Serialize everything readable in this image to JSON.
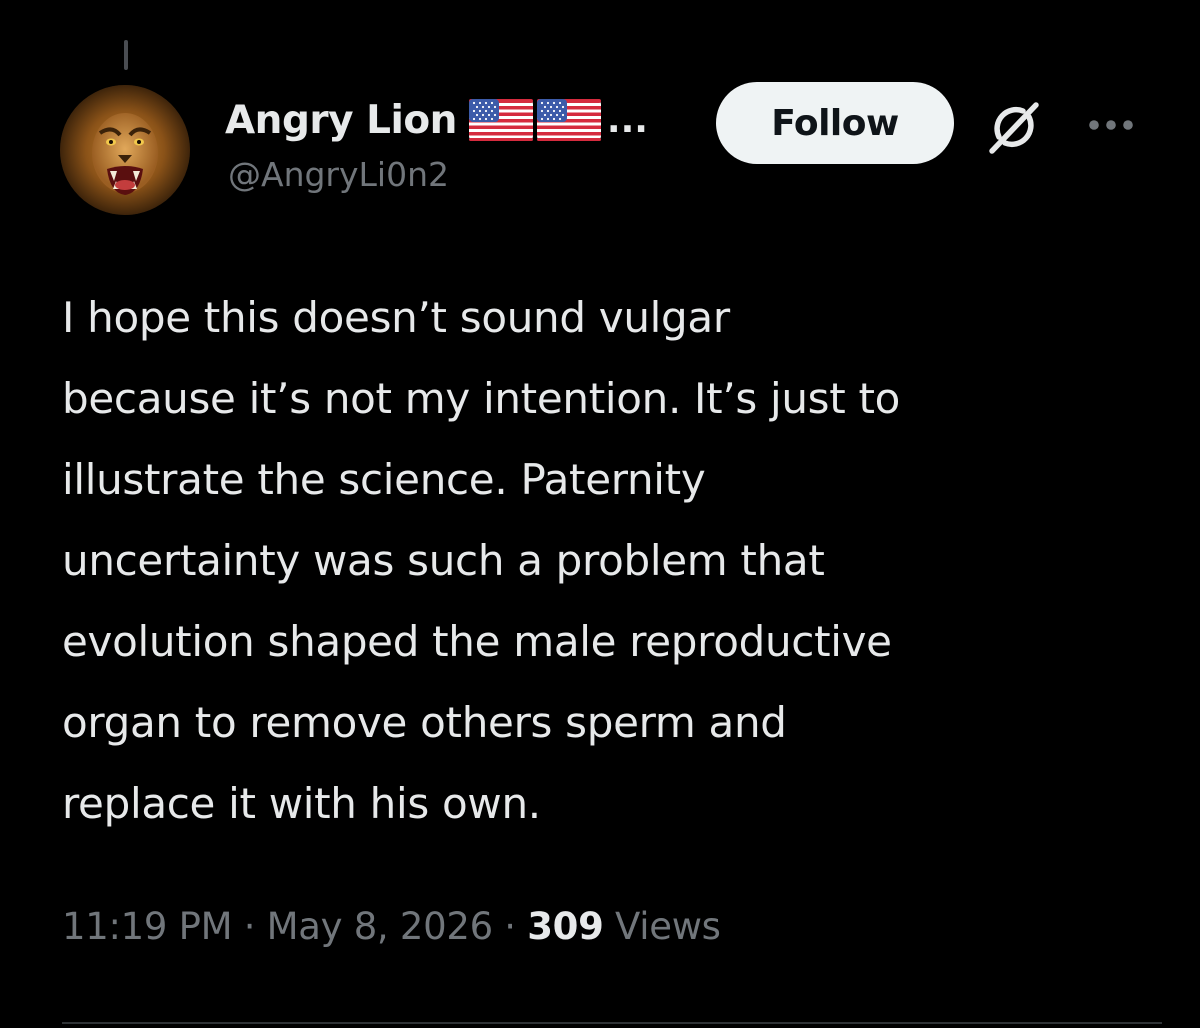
{
  "author": {
    "display_name": "Angry Lion",
    "name_flags": [
      "us-flag",
      "us-flag"
    ],
    "name_truncation": "...",
    "handle": "@AngryLi0n2",
    "avatar_icon": "lion-avatar"
  },
  "actions": {
    "follow_label": "Follow",
    "grok_icon": "grok-icon",
    "more_icon": "more-icon"
  },
  "tweet": {
    "lines": [
      "I hope this doesn’t sound vulgar",
      "because it’s not my intention. It’s just to",
      "illustrate the science. Paternity",
      "uncertainty was such a problem that",
      "evolution shaped the male reproductive",
      "organ to remove others sperm and",
      "replace it with his own."
    ]
  },
  "meta": {
    "time": "11:19 PM",
    "separator": "·",
    "date": "May 8, 2026",
    "views_count": "309",
    "views_label": "Views"
  },
  "colors": {
    "background": "#000000",
    "primary_text": "#e7e9ea",
    "secondary_text": "#71767b",
    "follow_bg": "#eff3f4",
    "divider": "#2f3336"
  }
}
